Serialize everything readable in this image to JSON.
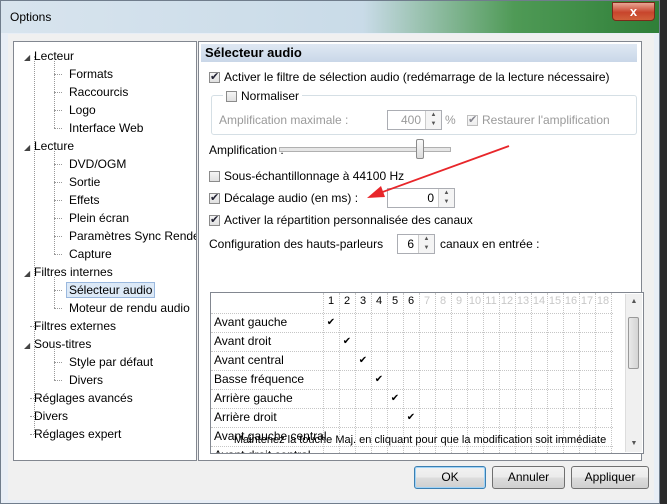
{
  "window": {
    "title": "Options",
    "close_glyph": "x"
  },
  "tree": {
    "items": [
      {
        "label": "Lecteur",
        "level": 0,
        "expanded": true
      },
      {
        "label": "Formats",
        "level": 1
      },
      {
        "label": "Raccourcis",
        "level": 1
      },
      {
        "label": "Logo",
        "level": 1
      },
      {
        "label": "Interface Web",
        "level": 1
      },
      {
        "label": "Lecture",
        "level": 0,
        "expanded": true
      },
      {
        "label": "DVD/OGM",
        "level": 1
      },
      {
        "label": "Sortie",
        "level": 1
      },
      {
        "label": "Effets",
        "level": 1
      },
      {
        "label": "Plein écran",
        "level": 1
      },
      {
        "label": "Paramètres Sync Render",
        "level": 1
      },
      {
        "label": "Capture",
        "level": 1
      },
      {
        "label": "Filtres internes",
        "level": 0,
        "expanded": true
      },
      {
        "label": "Sélecteur audio",
        "level": 1,
        "selected": true
      },
      {
        "label": "Moteur de rendu audio",
        "level": 1
      },
      {
        "label": "Filtres externes",
        "level": 0
      },
      {
        "label": "Sous-titres",
        "level": 0,
        "expanded": true
      },
      {
        "label": "Style par défaut",
        "level": 1
      },
      {
        "label": "Divers",
        "level": 1
      },
      {
        "label": "Réglages avancés",
        "level": 0
      },
      {
        "label": "Divers",
        "level": 0
      },
      {
        "label": "Réglages expert",
        "level": 0
      }
    ]
  },
  "panel": {
    "header": "Sélecteur audio",
    "enable_filter": "Activer le filtre de sélection audio (redémarrage de la lecture nécessaire)",
    "normaliser": "Normaliser",
    "amp_max_label": "Amplification maximale :",
    "amp_max_value": "400",
    "percent": "%",
    "restore_amp": "Restaurer l'amplification",
    "amplification_label": "Amplification :",
    "amplification_level": 0.83,
    "resample": "Sous-échantillonnage à 44100 Hz",
    "delay_label": "Décalage audio (en ms) :",
    "delay_value": "0",
    "custom_channels": "Activer la répartition personnalisée des canaux",
    "speaker_config_label": "Configuration des hauts-parleurs",
    "speaker_count": "6",
    "channels_in_label": "canaux en entrée :",
    "grid_columns": [
      "1",
      "2",
      "3",
      "4",
      "5",
      "6",
      "7",
      "8",
      "9",
      "10",
      "11",
      "12",
      "13",
      "14",
      "15",
      "16",
      "17",
      "18"
    ],
    "grid_rows": [
      {
        "label": "Avant gauche",
        "check": 1
      },
      {
        "label": "Avant droit",
        "check": 2
      },
      {
        "label": "Avant central",
        "check": 3
      },
      {
        "label": "Basse fréquence",
        "check": 4
      },
      {
        "label": "Arrière gauche",
        "check": 5
      },
      {
        "label": "Arrière droit",
        "check": 6
      },
      {
        "label": "Avant gauche central",
        "check": 0
      },
      {
        "label": "Avant droit central",
        "check": 0
      }
    ],
    "note": "Maintenez la touche Maj. en cliquant pour que la modification soit immédiate"
  },
  "buttons": {
    "ok": "OK",
    "cancel": "Annuler",
    "apply": "Appliquer"
  },
  "colors": {
    "arrow": "#e8262a",
    "selection": "#dce9f7"
  }
}
